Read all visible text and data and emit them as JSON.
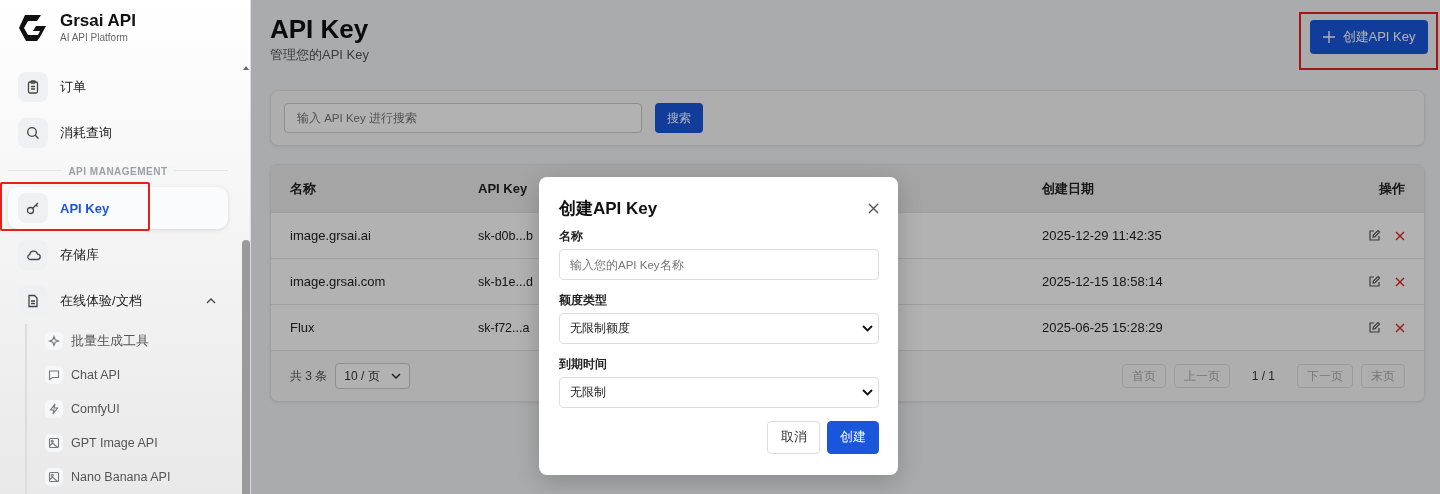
{
  "sidebar": {
    "logo": {
      "title": "Grsai API",
      "subtitle": "AI API Platform"
    },
    "items": [
      {
        "kind": "item",
        "label": "订单",
        "selected": false,
        "highlighted": false
      },
      {
        "kind": "item",
        "label": "消耗查询",
        "selected": false,
        "highlighted": false
      },
      {
        "kind": "section",
        "label": "API MANAGEMENT"
      },
      {
        "kind": "item",
        "label": "API Key",
        "selected": true,
        "highlighted": true
      },
      {
        "kind": "item",
        "label": "存储库",
        "selected": false,
        "highlighted": false
      },
      {
        "kind": "group",
        "label": "在线体验/文档",
        "expanded": true,
        "children": [
          {
            "label": "批量生成工具"
          },
          {
            "label": "Chat API"
          },
          {
            "label": "ComfyUI"
          },
          {
            "label": "GPT Image API"
          },
          {
            "label": "Nano Banana API"
          }
        ]
      }
    ]
  },
  "header": {
    "title": "API Key",
    "subtitle": "管理您的API Key",
    "create_button": {
      "label": "创建API Key",
      "highlighted": true
    }
  },
  "search": {
    "placeholder": "输入 API Key 进行搜索",
    "button": "搜索"
  },
  "table": {
    "columns": [
      "名称",
      "API Key",
      "创建日期",
      "操作"
    ],
    "rows": [
      {
        "name": "image.grsai.ai",
        "key": "sk-d0b...b",
        "created": "2025-12-29 11:42:35"
      },
      {
        "name": "image.grsai.com",
        "key": "sk-b1e...d",
        "created": "2025-12-15 18:58:14"
      },
      {
        "name": "Flux",
        "key": "sk-f72...a",
        "created": "2025-06-25 15:28:29"
      }
    ]
  },
  "pagination": {
    "total": "共 3 条",
    "page_size": "10 / 页",
    "page": "1 / 1",
    "buttons": [
      {
        "label": "首页",
        "disabled": true
      },
      {
        "label": "上一页",
        "disabled": true
      },
      {
        "label": "下一页",
        "disabled": true
      },
      {
        "label": "末页",
        "disabled": true
      }
    ]
  },
  "dialog": {
    "title": "创建API Key",
    "fields": [
      {
        "kind": "input",
        "label": "名称",
        "placeholder": "输入您的API Key名称"
      },
      {
        "kind": "select",
        "label": "额度类型",
        "value": "无限制额度"
      },
      {
        "kind": "select",
        "label": "到期时间",
        "value": "无限制"
      }
    ],
    "cancel": "取消",
    "confirm": "创建"
  }
}
